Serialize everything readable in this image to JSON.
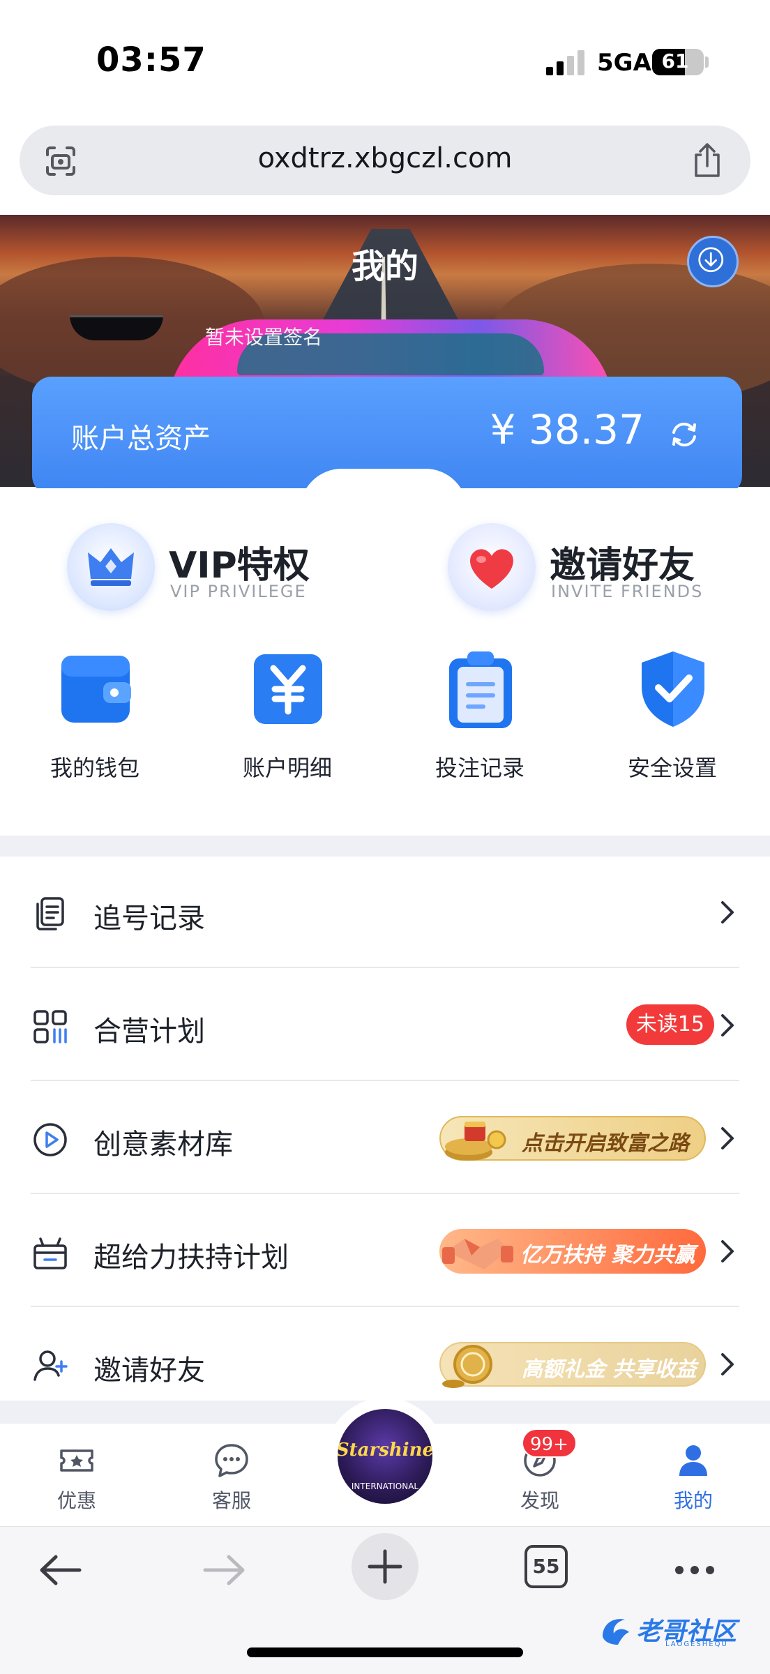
{
  "status_bar": {
    "time": "03:57",
    "network": "5GA",
    "battery": "61"
  },
  "browser": {
    "url": "oxdtrz.xbgczl.com",
    "tab_count": "55"
  },
  "header": {
    "title": "我的",
    "signature": "暂未设置签名"
  },
  "assets": {
    "label": "账户总资产",
    "value": "¥ 38.37"
  },
  "privileges": [
    {
      "title": "VIP特权",
      "subtitle": "VIP PRIVILEGE"
    },
    {
      "title": "邀请好友",
      "subtitle": "INVITE FRIENDS"
    }
  ],
  "quick_actions": [
    {
      "label": "我的钱包",
      "icon": "wallet-icon"
    },
    {
      "label": "账户明细",
      "icon": "yuan-icon"
    },
    {
      "label": "投注记录",
      "icon": "clipboard-icon"
    },
    {
      "label": "安全设置",
      "icon": "shield-check-icon"
    }
  ],
  "menu": [
    {
      "label": "追号记录",
      "icon": "copy-list-icon"
    },
    {
      "label": "合营计划",
      "icon": "grid-icon",
      "badge": "未读15"
    },
    {
      "label": "创意素材库",
      "icon": "play-circle-icon",
      "promo": "点击开启致富之路"
    },
    {
      "label": "超给力扶持计划",
      "icon": "gift-box-icon",
      "promo": "亿万扶持 聚力共赢"
    },
    {
      "label": "邀请好友",
      "icon": "user-plus-icon",
      "promo": "高额礼金 共享收益"
    }
  ],
  "tabbar": [
    {
      "label": "优惠",
      "icon": "ticket-star-icon"
    },
    {
      "label": "客服",
      "icon": "chat-icon"
    },
    {
      "label": "发现",
      "icon": "compass-icon",
      "badge": "99+"
    },
    {
      "label": "我的",
      "icon": "person-icon",
      "active": true
    }
  ],
  "center_logo": {
    "text": "Starshine",
    "sub": "INTERNATIONAL"
  },
  "watermark": {
    "text": "老哥社区",
    "sub": "LAOGESHEQU"
  },
  "colors": {
    "accent": "#3f85f2",
    "badge_red": "#f23a3a",
    "active_tab": "#2f6fe3"
  }
}
